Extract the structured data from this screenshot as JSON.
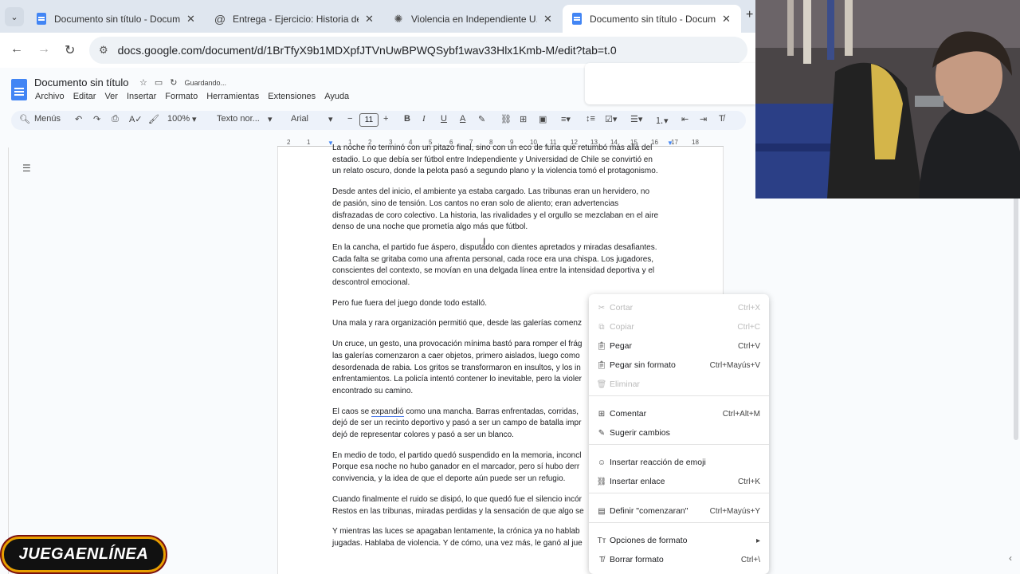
{
  "browser": {
    "tabs": [
      {
        "title": "Documento sin título - Docume",
        "active": false,
        "icon": "docs-icon"
      },
      {
        "title": "Entrega - Ejercicio: Historia de",
        "active": false,
        "icon": "moodle-icon"
      },
      {
        "title": "Violencia en Independiente U.",
        "active": false,
        "icon": "chatgpt-icon"
      },
      {
        "title": "Documento sin título - Docume",
        "active": true,
        "icon": "docs-icon"
      }
    ],
    "url": "docs.google.com/document/d/1BrTfyX9b1MDXpfJTVnUwBPWQSybf1wav33Hlx1Kmb-M/edit?tab=t.0"
  },
  "docs": {
    "title": "Documento sin título",
    "status": "Guardando...",
    "menu": [
      "Archivo",
      "Editar",
      "Ver",
      "Insertar",
      "Formato",
      "Herramientas",
      "Extensiones",
      "Ayuda"
    ],
    "toolbar": {
      "search": "Menús",
      "zoom": "100%",
      "style": "Texto nor...",
      "font": "Arial",
      "font_size": "11"
    },
    "ruler_marks": [
      "2",
      "1",
      "1",
      "2",
      "3",
      "4",
      "5",
      "6",
      "7",
      "8",
      "9",
      "10",
      "11",
      "12",
      "13",
      "14",
      "15",
      "16",
      "17",
      "18"
    ]
  },
  "document": {
    "paragraphs": [
      [
        "La noche no terminó con un pitazo final, sino con un eco de furia que retumbó más allá del",
        "estadio. Lo que debía ser fútbol entre Independiente y Universidad de Chile se convirtió en",
        "un relato oscuro, donde la pelota pasó a segundo plano y la violencia tomó el protagonismo."
      ],
      [
        "Desde antes del inicio, el ambiente ya estaba cargado. Las tribunas eran un hervidero, no",
        "de pasión, sino de tensión. Los cantos no eran solo de aliento; eran advertencias",
        "disfrazadas de coro colectivo. La historia, las rivalidades y el orgullo se mezclaban en el aire",
        "denso de una noche que prometía algo más que fútbol."
      ],
      [
        "En la cancha, el partido fue áspero, disputado con dientes apretados y miradas desafiantes.",
        "Cada falta se gritaba como una afrenta personal, cada roce era una chispa. Los jugadores,",
        "conscientes del contexto, se movían en una delgada línea entre la intensidad deportiva y el",
        "descontrol emocional."
      ],
      [
        "Pero fue fuera del juego donde todo estalló."
      ],
      [
        "Una mala y rara organización permitió que, desde las galerías comenz"
      ],
      [
        "Un cruce, un gesto, una provocación mínima bastó para romper el frág",
        "las galerías comenzaron a caer objetos, primero aislados, luego como",
        "desordenada de rabia. Los gritos se transformaron en insultos, y los in",
        "enfrentamientos. La policía intentó contener lo inevitable, pero la violer",
        "encontrado su camino."
      ],
      [
        "El caos se |expandió| como una mancha. Barras enfrentadas, corridas,",
        "dejó de ser un recinto deportivo y pasó a ser un campo de batalla impr",
        "dejó de representar colores y pasó a ser un blanco."
      ],
      [
        "En medio de todo, el partido quedó suspendido en la memoria, inconcl",
        "Porque esa noche no hubo ganador en el marcador, pero sí hubo derr",
        "convivencia, y la idea de que el deporte aún puede ser un refugio."
      ],
      [
        "Cuando finalmente el ruido se disipó, lo que quedó fue el silencio incór",
        "Restos en las tribunas, miradas perdidas y la sensación de que algo se"
      ],
      [
        "Y mientras las luces se apagaban lentamente, la crónica ya no hablab",
        "jugadas. Hablaba de violencia. Y de cómo, una vez más, le ganó al jue"
      ]
    ]
  },
  "context_menu": {
    "items": [
      {
        "label": "Cortar",
        "shortcut": "Ctrl+X",
        "icon": "cut-icon",
        "disabled": true
      },
      {
        "label": "Copiar",
        "shortcut": "Ctrl+C",
        "icon": "copy-icon",
        "disabled": true
      },
      {
        "label": "Pegar",
        "shortcut": "Ctrl+V",
        "icon": "paste-icon",
        "disabled": false
      },
      {
        "label": "Pegar sin formato",
        "shortcut": "Ctrl+Mayús+V",
        "icon": "paste-plain-icon",
        "disabled": false
      },
      {
        "label": "Eliminar",
        "shortcut": "",
        "icon": "delete-icon",
        "disabled": true
      },
      {
        "label": "Comentar",
        "shortcut": "Ctrl+Alt+M",
        "icon": "comment-icon",
        "disabled": false
      },
      {
        "label": "Sugerir cambios",
        "shortcut": "",
        "icon": "suggest-icon",
        "disabled": false
      },
      {
        "label": "Insertar reacción de emoji",
        "shortcut": "",
        "icon": "emoji-icon",
        "disabled": false
      },
      {
        "label": "Insertar enlace",
        "shortcut": "Ctrl+K",
        "icon": "link-icon",
        "disabled": false
      },
      {
        "label": "Definir \"comenzaran\"",
        "shortcut": "Ctrl+Mayús+Y",
        "icon": "define-icon",
        "disabled": false
      },
      {
        "label": "Opciones de formato",
        "shortcut": "▸",
        "icon": "format-icon",
        "disabled": false
      },
      {
        "label": "Borrar formato",
        "shortcut": "Ctrl+\\",
        "icon": "clear-format-icon",
        "disabled": false
      }
    ]
  },
  "overlay_logo": {
    "text": "JUEGAENLÍNEA"
  },
  "colors": {
    "accent": "#4285f4",
    "logo_border": "#e8a000"
  }
}
